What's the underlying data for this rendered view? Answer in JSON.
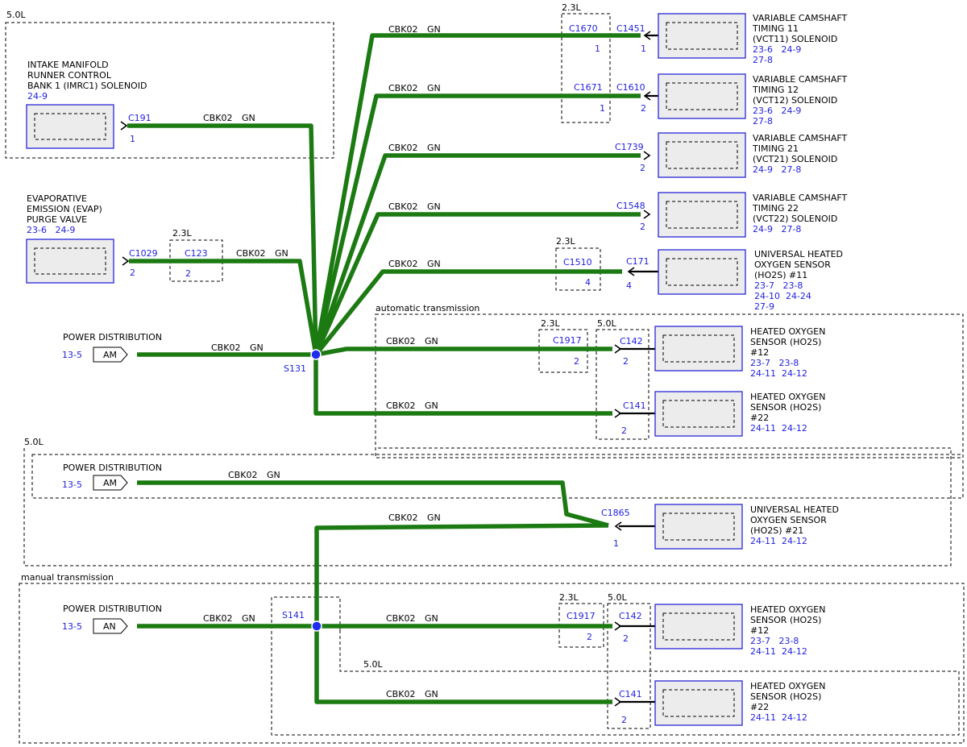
{
  "wire_circuit": "CBK02",
  "wire_color": "GN",
  "region_labels": {
    "top_left_5_0l": "5.0L",
    "auto_trans": "automatic transmission",
    "mid_5_0l": "5.0L",
    "manual_trans": "manual transmission",
    "bottom_5_0l": "5.0L"
  },
  "splices": {
    "s131": "S131",
    "s141": "S141"
  },
  "power": [
    {
      "title": "POWER DISTRIBUTION",
      "ref": "13-5",
      "tag": "AM"
    },
    {
      "title": "POWER DISTRIBUTION",
      "ref": "13-5",
      "tag": "AM"
    },
    {
      "title": "POWER DISTRIBUTION",
      "ref": "13-5",
      "tag": "AN"
    }
  ],
  "components": {
    "imrc": {
      "lines": [
        "INTAKE MANIFOLD",
        "RUNNER CONTROL",
        "BANK 1 (IMRC1) SOLENOID"
      ],
      "refs": [
        "24-9"
      ],
      "connector": "C191",
      "pin": "1"
    },
    "evap": {
      "lines": [
        "EVAPORATIVE",
        "EMISSION (EVAP)",
        "PURGE VALVE"
      ],
      "refs": [
        "23-6   24-9"
      ],
      "connector": "C1029",
      "pin": "2",
      "inline": "C123",
      "inline_pin": "2",
      "inline_label": "2.3L"
    },
    "vct11": {
      "lines": [
        "VARIABLE CAMSHAFT",
        "TIMING 11",
        "(VCT11) SOLENOID"
      ],
      "refs": [
        "23-6   24-9",
        "27-8"
      ],
      "connector": "C1451",
      "pin": "1",
      "inline": "C1670",
      "inline_pin": "1",
      "inline_label": "2.3L"
    },
    "vct12": {
      "lines": [
        "VARIABLE CAMSHAFT",
        "TIMING 12",
        "(VCT12) SOLENOID"
      ],
      "refs": [
        "23-6   24-9",
        "27-8"
      ],
      "connector": "C1610",
      "pin": "2",
      "inline": "C1671",
      "inline_pin": "1"
    },
    "vct21": {
      "lines": [
        "VARIABLE CAMSHAFT",
        "TIMING 21",
        "(VCT21) SOLENOID"
      ],
      "refs": [
        "24-9   27-8"
      ],
      "connector": "C1739",
      "pin": "2"
    },
    "vct22": {
      "lines": [
        "VARIABLE CAMSHAFT",
        "TIMING 22",
        "(VCT22) SOLENOID"
      ],
      "refs": [
        "24-9   27-8"
      ],
      "connector": "C1548",
      "pin": "2"
    },
    "uho2s11": {
      "lines": [
        "UNIVERSAL HEATED",
        "OXYGEN SENSOR",
        "(HO2S) #11"
      ],
      "refs": [
        "23-7   23-8",
        "24-10  24-24",
        "27-9"
      ],
      "connector": "C171",
      "pin": "4",
      "inline": "C1510",
      "inline_pin": "4",
      "inline_label": "2.3L"
    },
    "ho2s12a": {
      "lines": [
        "HEATED OXYGEN",
        "SENSOR (HO2S)",
        "#12"
      ],
      "refs": [
        "23-7   23-8",
        "24-11  24-12"
      ],
      "connector": "C142",
      "pin": "2",
      "inline": "C1917",
      "inline_pin": "2",
      "inline_label": "2.3L",
      "box_label": "5.0L"
    },
    "ho2s22a": {
      "lines": [
        "HEATED OXYGEN",
        "SENSOR (HO2S)",
        "#22"
      ],
      "refs": [
        "24-11  24-12"
      ],
      "connector": "C141",
      "pin": "2"
    },
    "uho2s21": {
      "lines": [
        "UNIVERSAL HEATED",
        "OXYGEN SENSOR",
        "(HO2S) #21"
      ],
      "refs": [
        "24-11  24-12"
      ],
      "connector": "C1865",
      "pin": "1"
    },
    "ho2s12b": {
      "lines": [
        "HEATED OXYGEN",
        "SENSOR (HO2S)",
        "#12"
      ],
      "refs": [
        "23-7   23-8",
        "24-11  24-12"
      ],
      "connector": "C142",
      "pin": "2",
      "inline": "C1917",
      "inline_pin": "2",
      "inline_label": "2.3L",
      "box_label": "5.0L"
    },
    "ho2s22b": {
      "lines": [
        "HEATED OXYGEN",
        "SENSOR (HO2S)",
        "#22"
      ],
      "refs": [
        "24-11  24-12"
      ],
      "connector": "C141",
      "pin": "2"
    }
  }
}
